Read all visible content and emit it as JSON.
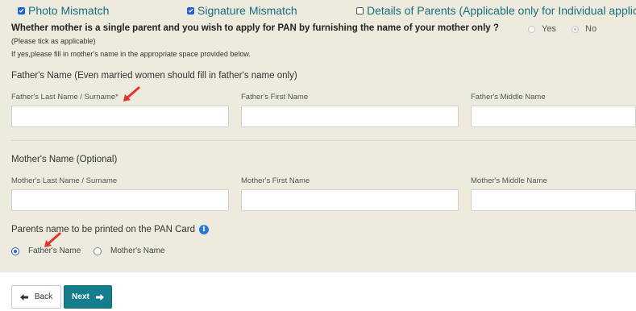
{
  "checkboxes": {
    "photo_mismatch": "Photo Mismatch",
    "signature_mismatch": "Signature Mismatch",
    "details_of_parents": "Details of Parents (Applicable only for Individual applicants)"
  },
  "single_parent": {
    "question": "Whether mother is a single parent and you wish to apply for PAN by furnishing the name of your mother only ?",
    "hint": "(Please tick as applicable)",
    "note": "If yes,please fill in mother's name in the appropriate space provided below.",
    "yes_label": "Yes",
    "no_label": "No"
  },
  "father": {
    "title": "Father's Name (Even married women should fill in father's name only)",
    "last_label": "Father's Last Name / Surname*",
    "first_label": "Father's First Name",
    "middle_label": "Father's Middle Name",
    "last_value": "",
    "first_value": "",
    "middle_value": ""
  },
  "mother": {
    "title": "Mother's Name (Optional)",
    "last_label": "Mother's Last Name / Surname",
    "first_label": "Mother's First Name",
    "middle_label": "Mother's Middle Name",
    "last_value": "",
    "first_value": "",
    "middle_value": ""
  },
  "pan_name": {
    "title": "Parents name to be printed on the PAN Card",
    "info_glyph": "i",
    "fathers_label": "Father's Name",
    "mothers_label": "Mother's Name"
  },
  "nav": {
    "back_label": "Back",
    "next_label": "Next"
  },
  "colors": {
    "panel_bg": "#ecebdd",
    "accent": "#157e8c",
    "annotation_arrow": "#e8322e"
  },
  "icons": {
    "back": "arrow-left-icon",
    "next": "arrow-right-icon",
    "info": "info-icon",
    "annotation": "red-arrow-icon"
  }
}
